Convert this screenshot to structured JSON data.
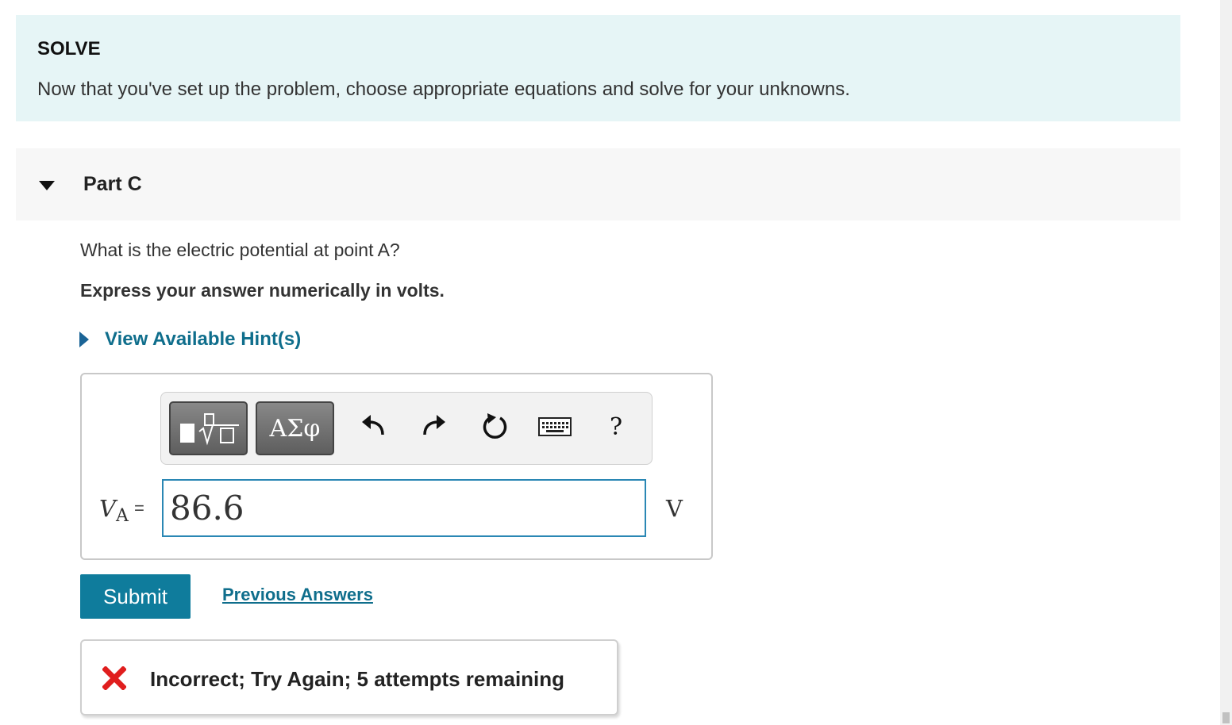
{
  "solve": {
    "title": "SOLVE",
    "text": "Now that you've set up the problem, choose appropriate equations and solve for your unknowns."
  },
  "part": {
    "title": "Part C",
    "question": "What is the electric potential at point A?",
    "instruction": "Express your answer numerically in volts.",
    "hint_label": "View Available Hint(s)"
  },
  "toolbar": {
    "greek_label": "ΑΣφ",
    "help_label": "?"
  },
  "answer": {
    "variable": "V",
    "subscript": "A",
    "equals": "=",
    "value": "86.6",
    "unit": "V"
  },
  "actions": {
    "submit_label": "Submit",
    "previous_answers_label": "Previous Answers"
  },
  "feedback": {
    "message": "Incorrect; Try Again; 5 attempts remaining",
    "icon": "x-icon",
    "color": "#e01e1e"
  },
  "colors": {
    "accent": "#0f7c9c",
    "link": "#0f6e8c",
    "solve_bg": "#e6f5f6"
  }
}
